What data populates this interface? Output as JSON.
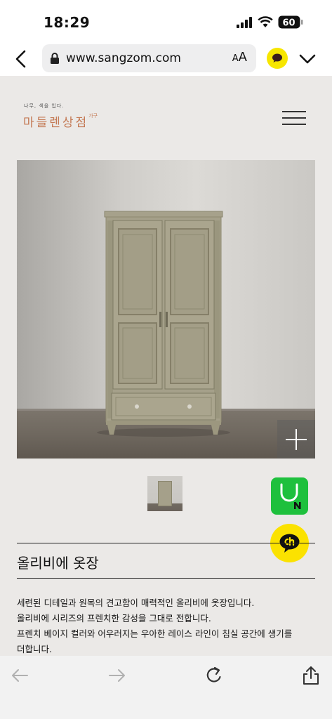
{
  "status_bar": {
    "time": "18:29",
    "battery": "60"
  },
  "browser": {
    "url": "www.sangzom.com",
    "text_size_label_small": "A",
    "text_size_label_large": "A"
  },
  "header": {
    "tagline": "나무, 색을 입다.",
    "brand": "마들렌상점",
    "brand_suffix": "가구"
  },
  "product": {
    "title": "올리비에 옷장",
    "description": [
      "세련된 디테일과 원목의 견고함이 매력적인 올리비에 옷장입니다.",
      "올리비에 시리즈의 프렌치한 감성을 그대로 전합니다.",
      "프렌치 베이지 컬러와 어우러지는 우아한 레이스 라인이 침실 공간에 생기를",
      "더합니다."
    ]
  },
  "colors": {
    "brand": "#c47a55",
    "naver_green": "#1ec03d",
    "kakao_yellow": "#fbe200",
    "wardrobe": "#a5a08a"
  },
  "icons": [
    "back-icon",
    "lock-icon",
    "kakao-icon",
    "chevron-down-icon",
    "menu-icon",
    "plus-icon",
    "naver-talk-icon",
    "kakao-channel-icon",
    "arrow-left-icon",
    "arrow-right-icon",
    "reload-icon",
    "share-icon"
  ]
}
